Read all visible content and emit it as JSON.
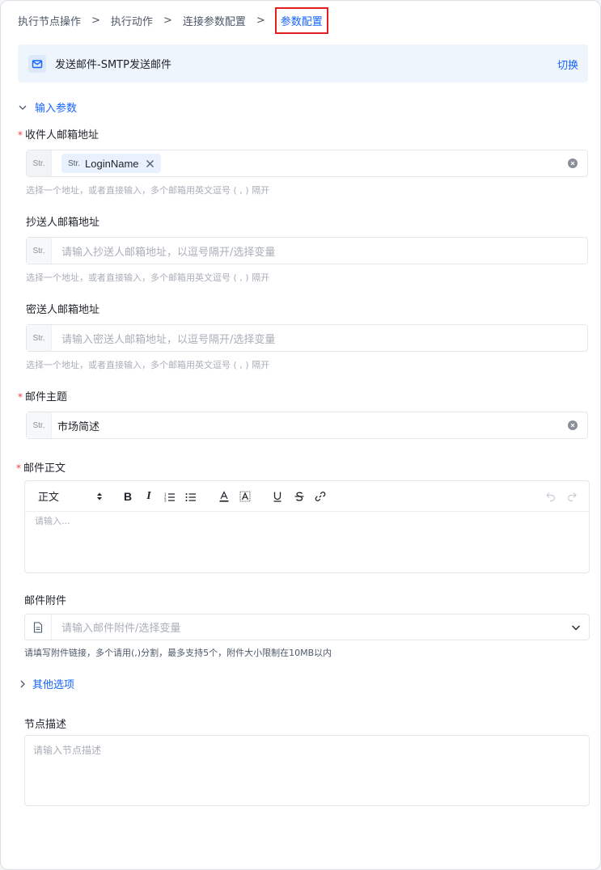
{
  "breadcrumb": {
    "items": [
      "执行节点操作",
      "执行动作",
      "连接参数配置"
    ],
    "separator": ">",
    "active": "参数配置"
  },
  "action": {
    "title": "发送邮件-SMTP发送邮件",
    "switch_label": "切换",
    "icon": "mail-icon"
  },
  "input_section": {
    "label": "输入参数",
    "expanded": true
  },
  "fields": {
    "to": {
      "label": "收件人邮箱地址",
      "required": "*",
      "type_tag": "Str.",
      "chip_type": "Str.",
      "chip_value": "LoginName",
      "hint": "选择一个地址，或者直接输入，多个邮箱用英文逗号 ( , ) 隔开"
    },
    "cc": {
      "label": "抄送人邮箱地址",
      "type_tag": "Str.",
      "placeholder": "请输入抄送人邮箱地址，以逗号隔开/选择变量",
      "hint": "选择一个地址，或者直接输入，多个邮箱用英文逗号 ( , ) 隔开"
    },
    "bcc": {
      "label": "密送人邮箱地址",
      "type_tag": "Str.",
      "placeholder": "请输入密送人邮箱地址，以逗号隔开/选择变量",
      "hint": "选择一个地址，或者直接输入，多个邮箱用英文逗号 ( , ) 隔开"
    },
    "subject": {
      "label": "邮件主题",
      "required": "*",
      "type_tag": "Str.",
      "value": "市场简述"
    },
    "body": {
      "label": "邮件正文",
      "required": "*",
      "format_select": "正文",
      "placeholder": "请输入..."
    },
    "attachment": {
      "label": "邮件附件",
      "placeholder": "请输入邮件附件/选择变量",
      "hint": "请填写附件链接，多个请用(,)分割，最多支持5个，附件大小限制在10MB以内"
    }
  },
  "other_section": {
    "label": "其他选项",
    "expanded": false
  },
  "node_desc": {
    "label": "节点描述",
    "placeholder": "请输入节点描述"
  },
  "colors": {
    "accent": "#1664ff",
    "required": "#f53f3f",
    "highlight_border": "#e02020",
    "card_bg": "#eef5fd"
  }
}
